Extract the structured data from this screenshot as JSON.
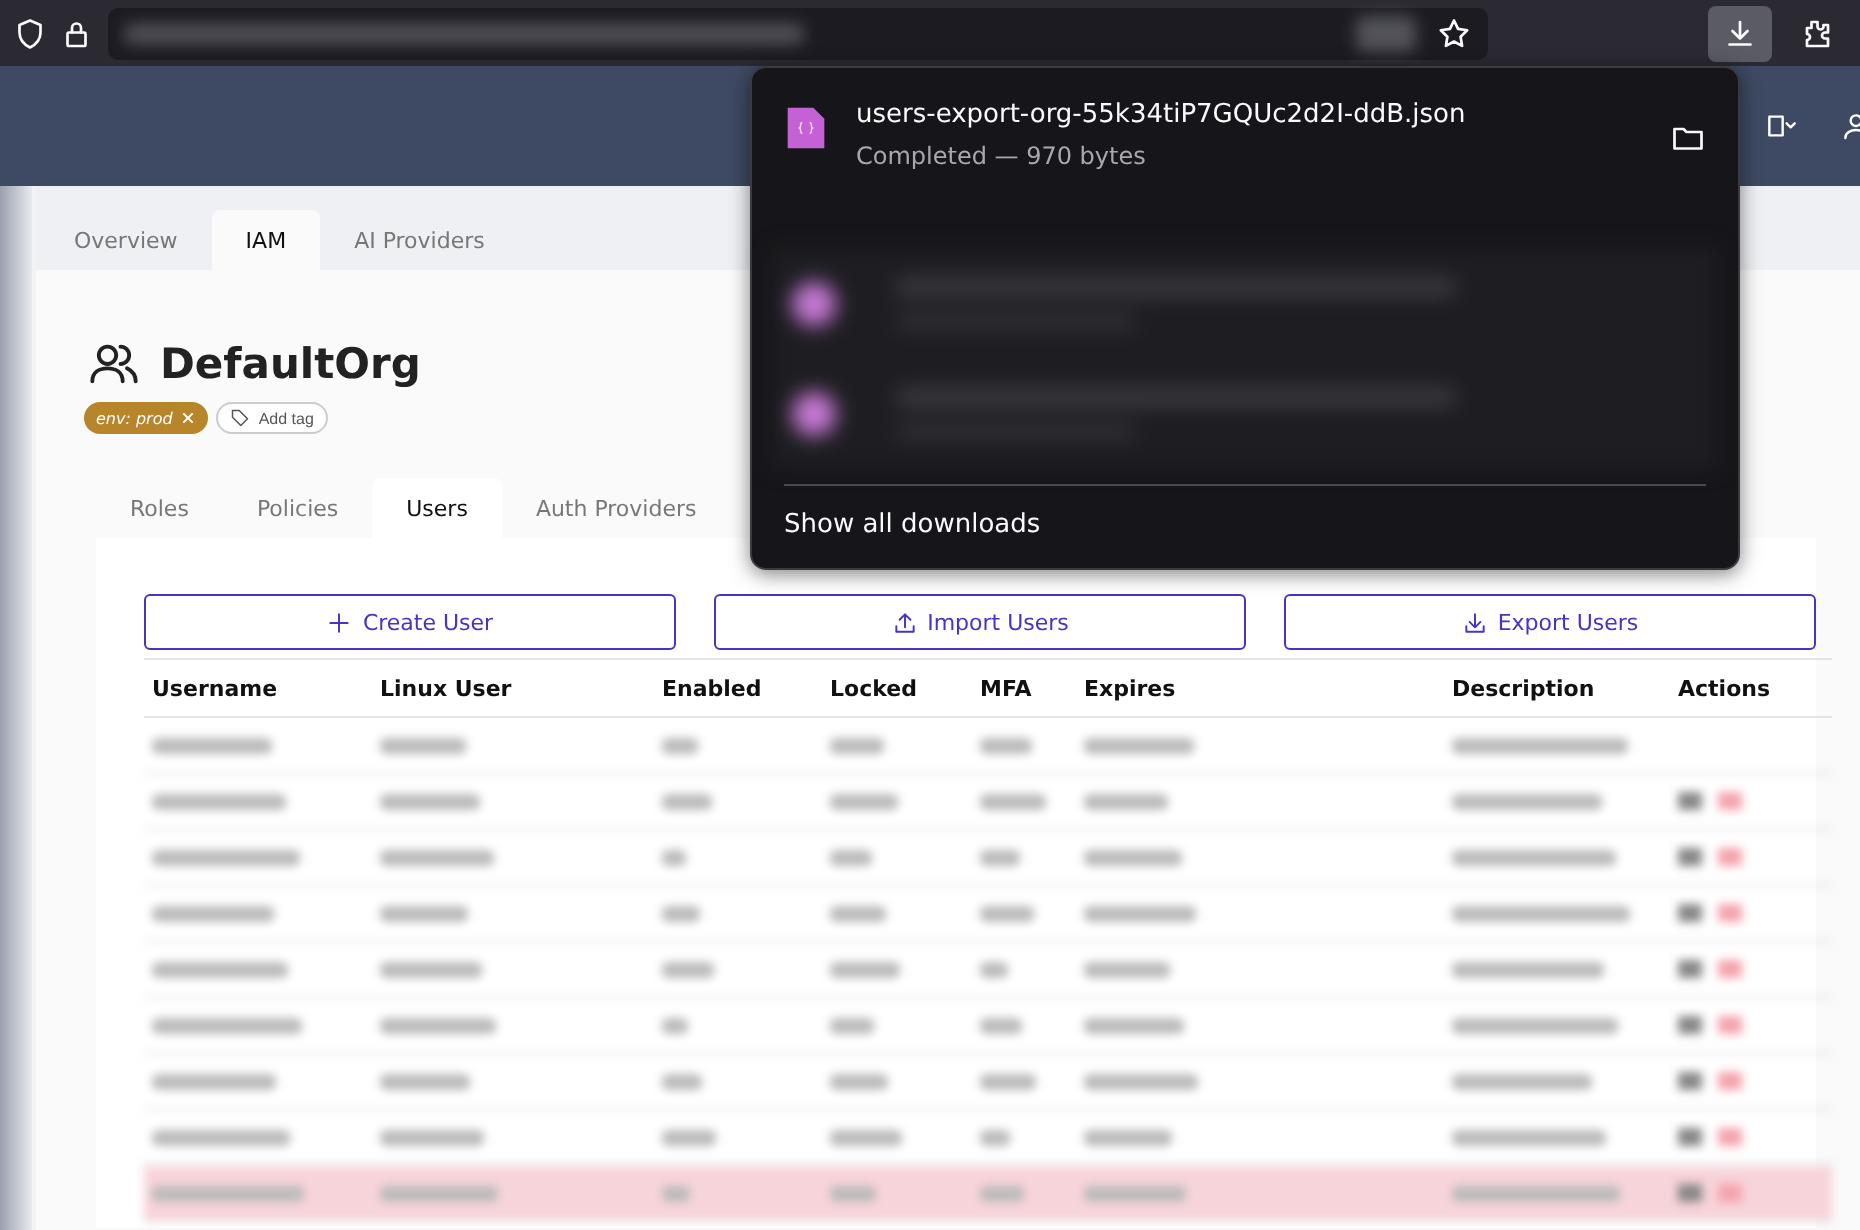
{
  "browser": {
    "download_button": {
      "active": true
    }
  },
  "download_panel": {
    "current": {
      "filename": "users-export-org-55k34tiP7GQUc2d2I-ddB.json",
      "status": "Completed — 970 bytes"
    },
    "hidden_downloads": [
      {
        "kind": "blurred"
      },
      {
        "kind": "blurred"
      }
    ],
    "show_all": "Show all downloads"
  },
  "tabs": [
    {
      "label": "Overview",
      "selected": false
    },
    {
      "label": "IAM",
      "selected": true
    },
    {
      "label": "AI Providers",
      "selected": false
    }
  ],
  "org": {
    "name": "DefaultOrg",
    "tags": [
      {
        "kind": "tag",
        "label": "env: prod"
      },
      {
        "kind": "add",
        "label": "Add tag"
      }
    ]
  },
  "subtabs": [
    {
      "label": "Roles",
      "selected": false
    },
    {
      "label": "Policies",
      "selected": false
    },
    {
      "label": "Users",
      "selected": true
    },
    {
      "label": "Auth Providers",
      "selected": false
    }
  ],
  "buttons": [
    {
      "kind": "create",
      "label": "Create User"
    },
    {
      "kind": "import",
      "label": "Import Users"
    },
    {
      "kind": "export",
      "label": "Export Users"
    }
  ],
  "table": {
    "columns": [
      "Username",
      "Linux User",
      "Enabled",
      "Locked",
      "MFA",
      "Expires",
      "Description",
      "Actions"
    ],
    "rows": [
      {
        "kind": "blurred",
        "highlighted": false,
        "actions": false
      },
      {
        "kind": "blurred",
        "highlighted": false,
        "actions": true
      },
      {
        "kind": "blurred",
        "highlighted": false,
        "actions": true
      },
      {
        "kind": "blurred",
        "highlighted": false,
        "actions": true
      },
      {
        "kind": "blurred",
        "highlighted": false,
        "actions": true
      },
      {
        "kind": "blurred",
        "highlighted": false,
        "actions": true
      },
      {
        "kind": "blurred",
        "highlighted": false,
        "actions": true
      },
      {
        "kind": "blurred",
        "highlighted": false,
        "actions": true
      },
      {
        "kind": "blurred",
        "highlighted": true,
        "actions": true
      }
    ]
  }
}
